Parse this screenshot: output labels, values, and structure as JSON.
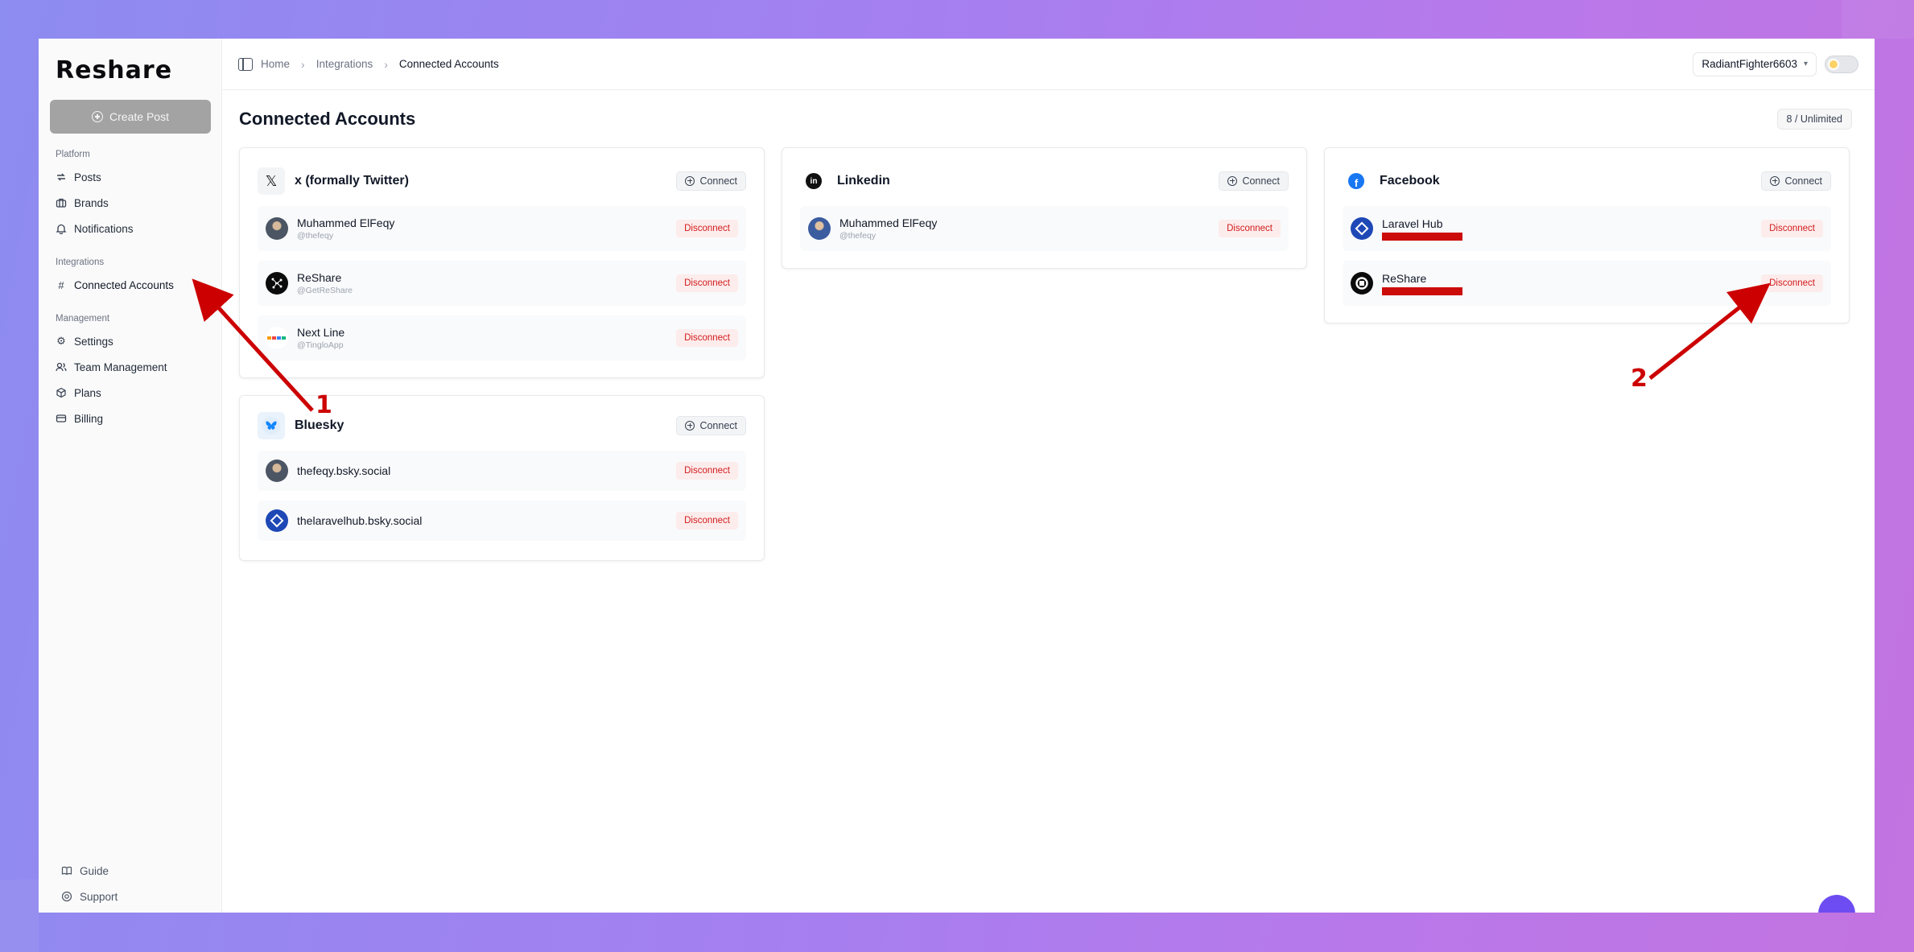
{
  "app": {
    "logo": "Reshare",
    "create_post_label": "Create Post"
  },
  "sidebar": {
    "sections": [
      {
        "label": "Platform",
        "items": [
          {
            "label": "Posts",
            "icon": "repost-icon"
          },
          {
            "label": "Brands",
            "icon": "briefcase-icon"
          },
          {
            "label": "Notifications",
            "icon": "bell-icon"
          }
        ]
      },
      {
        "label": "Integrations",
        "items": [
          {
            "label": "Connected Accounts",
            "icon": "hash-icon"
          }
        ]
      },
      {
        "label": "Management",
        "items": [
          {
            "label": "Settings",
            "icon": "gear-icon"
          },
          {
            "label": "Team Management",
            "icon": "users-icon"
          },
          {
            "label": "Plans",
            "icon": "box-icon"
          },
          {
            "label": "Billing",
            "icon": "credit-card-icon"
          }
        ]
      }
    ],
    "bottom": [
      {
        "label": "Guide",
        "icon": "book-icon"
      },
      {
        "label": "Support",
        "icon": "lifebuoy-icon"
      }
    ]
  },
  "topbar": {
    "breadcrumbs": [
      "Home",
      "Integrations",
      "Connected Accounts"
    ],
    "user": "RadiantFighter6603"
  },
  "page": {
    "title": "Connected Accounts",
    "quota": "8 / Unlimited",
    "connect_label": "Connect",
    "disconnect_label": "Disconnect"
  },
  "platforms": {
    "x": {
      "name": "x (formally Twitter)",
      "accounts": [
        {
          "name": "Muhammed ElFeqy",
          "handle": "@thefeqy"
        },
        {
          "name": "ReShare",
          "handle": "@GetReShare"
        },
        {
          "name": "Next Line",
          "handle": "@TingloApp"
        }
      ]
    },
    "linkedin": {
      "name": "Linkedin",
      "accounts": [
        {
          "name": "Muhammed ElFeqy",
          "handle": "@thefeqy"
        }
      ]
    },
    "facebook": {
      "name": "Facebook",
      "accounts": [
        {
          "name": "Laravel Hub"
        },
        {
          "name": "ReShare"
        }
      ]
    },
    "bluesky": {
      "name": "Bluesky",
      "accounts": [
        {
          "name": "thefeqy.bsky.social"
        },
        {
          "name": "thelaravelhub.bsky.social"
        }
      ]
    }
  },
  "annotations": [
    "1",
    "2"
  ],
  "colors": {
    "accent_red": "#cc0b0b",
    "disconnect_text": "#d21b1b",
    "create_button": "#a3a3a3"
  }
}
